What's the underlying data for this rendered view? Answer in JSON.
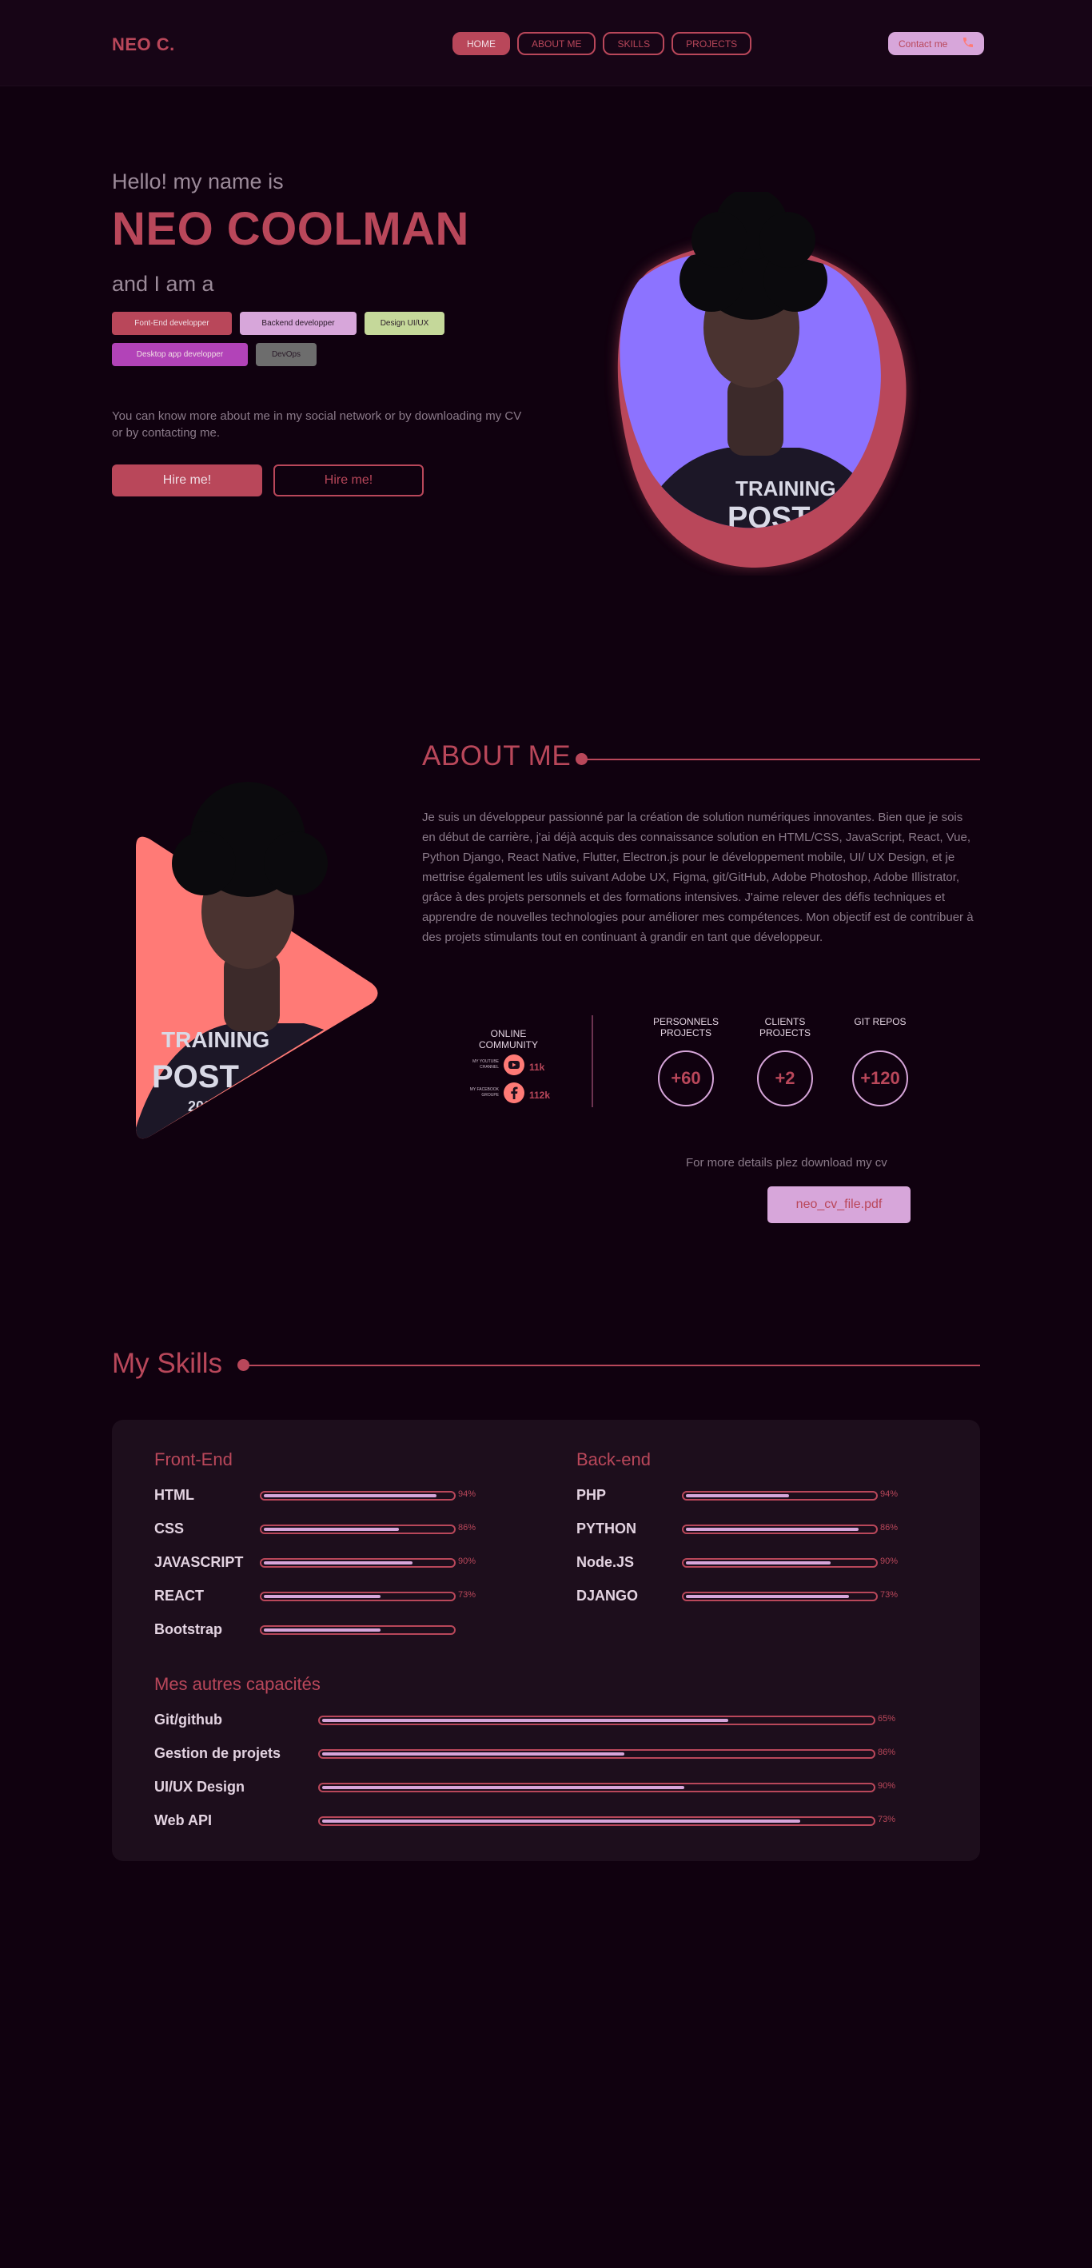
{
  "header": {
    "logo": "NEO C.",
    "nav": [
      {
        "label": "HOME",
        "active": true
      },
      {
        "label": "ABOUT ME",
        "active": false
      },
      {
        "label": "SKILLS",
        "active": false
      },
      {
        "label": "PROJECTS",
        "active": false
      }
    ],
    "contact_label": "Contact me",
    "contact_icon": "phone-icon"
  },
  "hero": {
    "greeting": "Hello! my name is",
    "name": "NEO COOLMAN",
    "iam": "and I am a",
    "tags": [
      {
        "label": "Font-End developper",
        "bg": "#b9475a",
        "fg": "#f0dde4"
      },
      {
        "label": "Backend developper",
        "bg": "#d7a6da",
        "fg": "#2a1a29"
      },
      {
        "label": "Design UI/UX",
        "bg": "#c5d89a",
        "fg": "#2a1a29"
      },
      {
        "label": "Desktop app developper",
        "bg": "#b243b8",
        "fg": "#f0dde4"
      },
      {
        "label": "DevOps",
        "bg": "#6d6d6d",
        "fg": "#2a1a29"
      }
    ],
    "description": "You can know more about me in my social network or by downloading my CV or by contacting me.",
    "hire_primary": "Hire me!",
    "hire_secondary": "Hire me!",
    "colors": {
      "blob": "#b9475a",
      "photo_bg": "#8c73ff"
    }
  },
  "about": {
    "title": "ABOUT ME",
    "text": "Je suis un développeur passionné par la création de solution numériques innovantes. Bien que je sois en début de carrière, j'ai déjà acquis des connaissance solution en HTML/CSS, JavaScript, React, Vue, Python Django, React Native, Flutter, Electron.js pour le développement mobile, UI/ UX Design, et je mettrise également les utils suivant Adobe UX, Figma, git/GitHub, Adobe Photoshop, Adobe Illistrator, grâce à des projets personnels et des formations intensives. J'aime relever des défis techniques et apprendre de nouvelles technologies pour améliorer mes compétences. Mon objectif est de contribuer à des projets stimulants tout en continuant à grandir en tant que développeur.",
    "community": {
      "title": "ONLINE COMMUNITY",
      "youtube": {
        "label": "MY YOUTUBE CHANNEL",
        "count": "11k",
        "icon": "youtube-icon"
      },
      "facebook": {
        "label": "MY FACEBOOK GROUPE",
        "count": "112k",
        "icon": "facebook-icon"
      }
    },
    "stats": [
      {
        "label": "PERSONNELS PROJECTS",
        "value": "+60"
      },
      {
        "label": "CLIENTS PROJECTS",
        "value": "+2"
      },
      {
        "label": "GIT REPOS",
        "value": "+120"
      }
    ],
    "cv_label": "For more details plez download my  cv",
    "cv_button": "neo_cv_file.pdf",
    "colors": {
      "triangle": "#ff7a76"
    }
  },
  "skills": {
    "title": "My Skills",
    "frontend": {
      "title": "Front-End",
      "items": [
        {
          "name": "HTML",
          "pct": "94%",
          "level": 0.92
        },
        {
          "name": "CSS",
          "pct": "86%",
          "level": 0.72
        },
        {
          "name": "JAVASCRIPT",
          "pct": "90%",
          "level": 0.79
        },
        {
          "name": "REACT",
          "pct": "73%",
          "level": 0.62
        },
        {
          "name": "Bootstrap",
          "pct": "",
          "level": 0.62
        }
      ]
    },
    "backend": {
      "title": "Back-end",
      "items": [
        {
          "name": "PHP",
          "pct": "94%",
          "level": 0.55
        },
        {
          "name": "PYTHON",
          "pct": "86%",
          "level": 0.92
        },
        {
          "name": "Node.JS",
          "pct": "90%",
          "level": 0.77
        },
        {
          "name": "DJANGO",
          "pct": "73%",
          "level": 0.87
        }
      ]
    },
    "others": {
      "title": "Mes autres capacités",
      "items": [
        {
          "name": "Git/github",
          "pct": "65%",
          "level": 0.74
        },
        {
          "name": "Gestion de projets",
          "pct": "86%",
          "level": 0.55
        },
        {
          "name": "UI/UX Design",
          "pct": "90%",
          "level": 0.66
        },
        {
          "name": "Web API",
          "pct": "73%",
          "level": 0.87
        }
      ]
    }
  }
}
